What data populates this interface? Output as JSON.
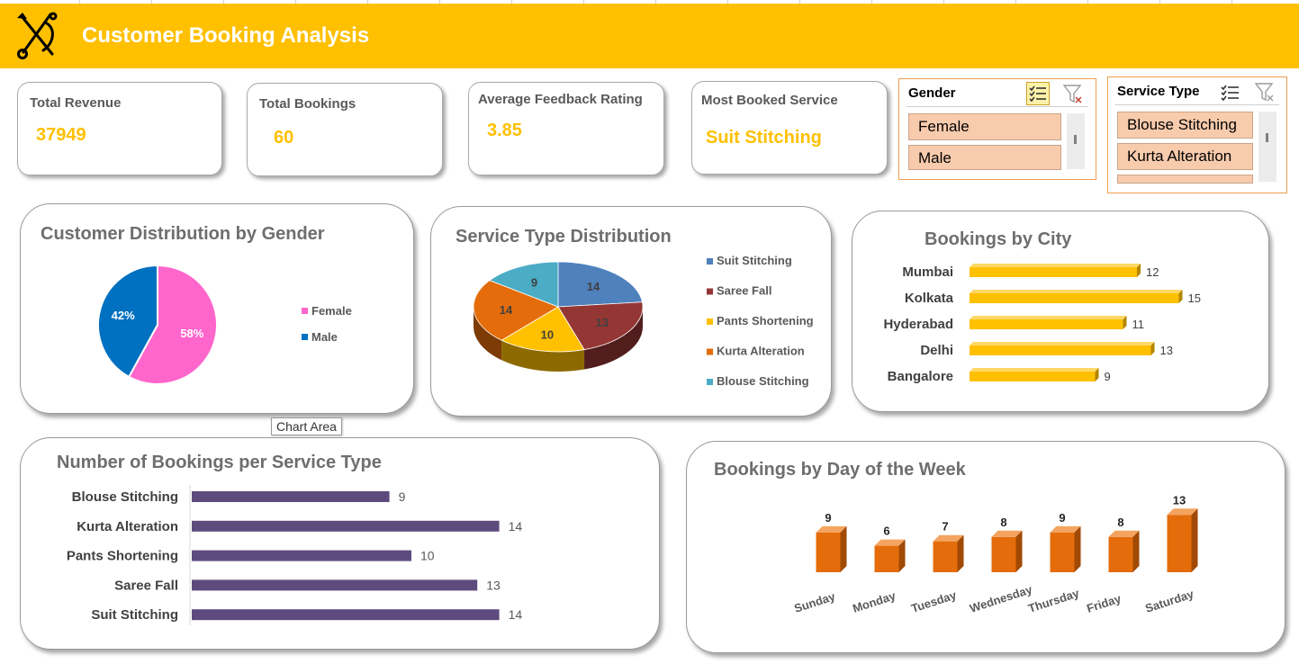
{
  "header": {
    "title": "Customer Booking Analysis"
  },
  "kpis": [
    {
      "label": "Total Revenue",
      "value": "37949"
    },
    {
      "label": "Total Bookings",
      "value": "60"
    },
    {
      "label": "Average Feedback Rating",
      "value": "3.85"
    },
    {
      "label": "Most Booked Service",
      "value": "Suit Stitching"
    }
  ],
  "slicers": {
    "gender": {
      "title": "Gender",
      "items": [
        "Female",
        "Male"
      ]
    },
    "service_type": {
      "title": "Service Type",
      "items": [
        "Blouse Stitching",
        "Kurta Alteration"
      ]
    }
  },
  "tooltip": "Chart Area",
  "colors": {
    "accent": "#FFC000",
    "female": "#FF66CC",
    "male": "#0070C0",
    "bar_purple": "#5E4B7E",
    "bar_orange": "#E46C0A"
  },
  "chart_data": [
    {
      "type": "pie",
      "title": "Customer Distribution by Gender",
      "series": [
        {
          "name": "Female",
          "value": 58,
          "label": "58%",
          "color": "#FF66CC"
        },
        {
          "name": "Male",
          "value": 42,
          "label": "42%",
          "color": "#0070C0"
        }
      ],
      "legend": "right"
    },
    {
      "type": "pie",
      "title": "Service Type Distribution",
      "style": "3d",
      "series": [
        {
          "name": "Suit Stitching",
          "value": 14,
          "color": "#4F81BD"
        },
        {
          "name": "Saree Fall",
          "value": 13,
          "color": "#943634"
        },
        {
          "name": "Pants Shortening",
          "value": 10,
          "color": "#FFC000"
        },
        {
          "name": "Kurta Alteration",
          "value": 14,
          "color": "#E46C0A"
        },
        {
          "name": "Blouse Stitching",
          "value": 9,
          "color": "#4BACC6"
        }
      ],
      "legend": "right"
    },
    {
      "type": "bar",
      "orientation": "horizontal",
      "title": "Bookings by City",
      "categories": [
        "Mumbai",
        "Kolkata",
        "Hyderabad",
        "Delhi",
        "Bangalore"
      ],
      "values": [
        12,
        15,
        11,
        13,
        9
      ],
      "color": "#FFC000"
    },
    {
      "type": "bar",
      "orientation": "horizontal",
      "title": "Number of Bookings per Service Type",
      "categories": [
        "Blouse Stitching",
        "Kurta Alteration",
        "Pants Shortening",
        "Saree Fall",
        "Suit Stitching"
      ],
      "values": [
        9,
        14,
        10,
        13,
        14
      ],
      "color": "#5E4B7E"
    },
    {
      "type": "bar",
      "title": "Bookings by Day of the Week",
      "categories": [
        "Sunday",
        "Monday",
        "Tuesday",
        "Wednesday",
        "Thursday",
        "Friday",
        "Saturday"
      ],
      "values": [
        9,
        6,
        7,
        8,
        9,
        8,
        13
      ],
      "color": "#E46C0A"
    }
  ]
}
